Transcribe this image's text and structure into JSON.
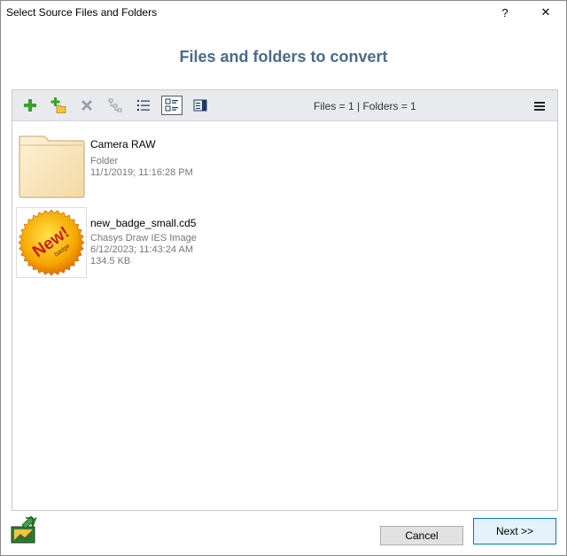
{
  "window": {
    "title": "Select Source Files and Folders",
    "help_label": "?",
    "close_label": "✕"
  },
  "header": {
    "title": "Files and folders to convert"
  },
  "toolbar": {
    "tools": [
      "add-icon",
      "add-folder-icon",
      "remove-icon",
      "tree-icon",
      "list-view-icon",
      "details-view-icon",
      "preview-pane-icon"
    ],
    "counts_text": "Files = 1 | Folders = 1",
    "menu_icon": "hamburger-menu-icon"
  },
  "items": [
    {
      "name": "Camera RAW",
      "type": "Folder",
      "date": "11/1/2019; 11:16:28 PM",
      "size": ""
    },
    {
      "name": "new_badge_small.cd5",
      "type": "Chasys Draw IES Image",
      "date": "6/12/2023; 11:43:24 AM",
      "size": "134.5 KB",
      "badge_text": "New!",
      "badge_subtext": "badge"
    }
  ],
  "footer": {
    "cancel_label": "Cancel",
    "next_label": "Next >>"
  },
  "colors": {
    "heading": "#4a6b8a",
    "toolbar_bg": "#e8eaed",
    "add_green": "#3aa02a",
    "badge_orange": "#f08c00",
    "badge_text": "#c81e1e"
  }
}
